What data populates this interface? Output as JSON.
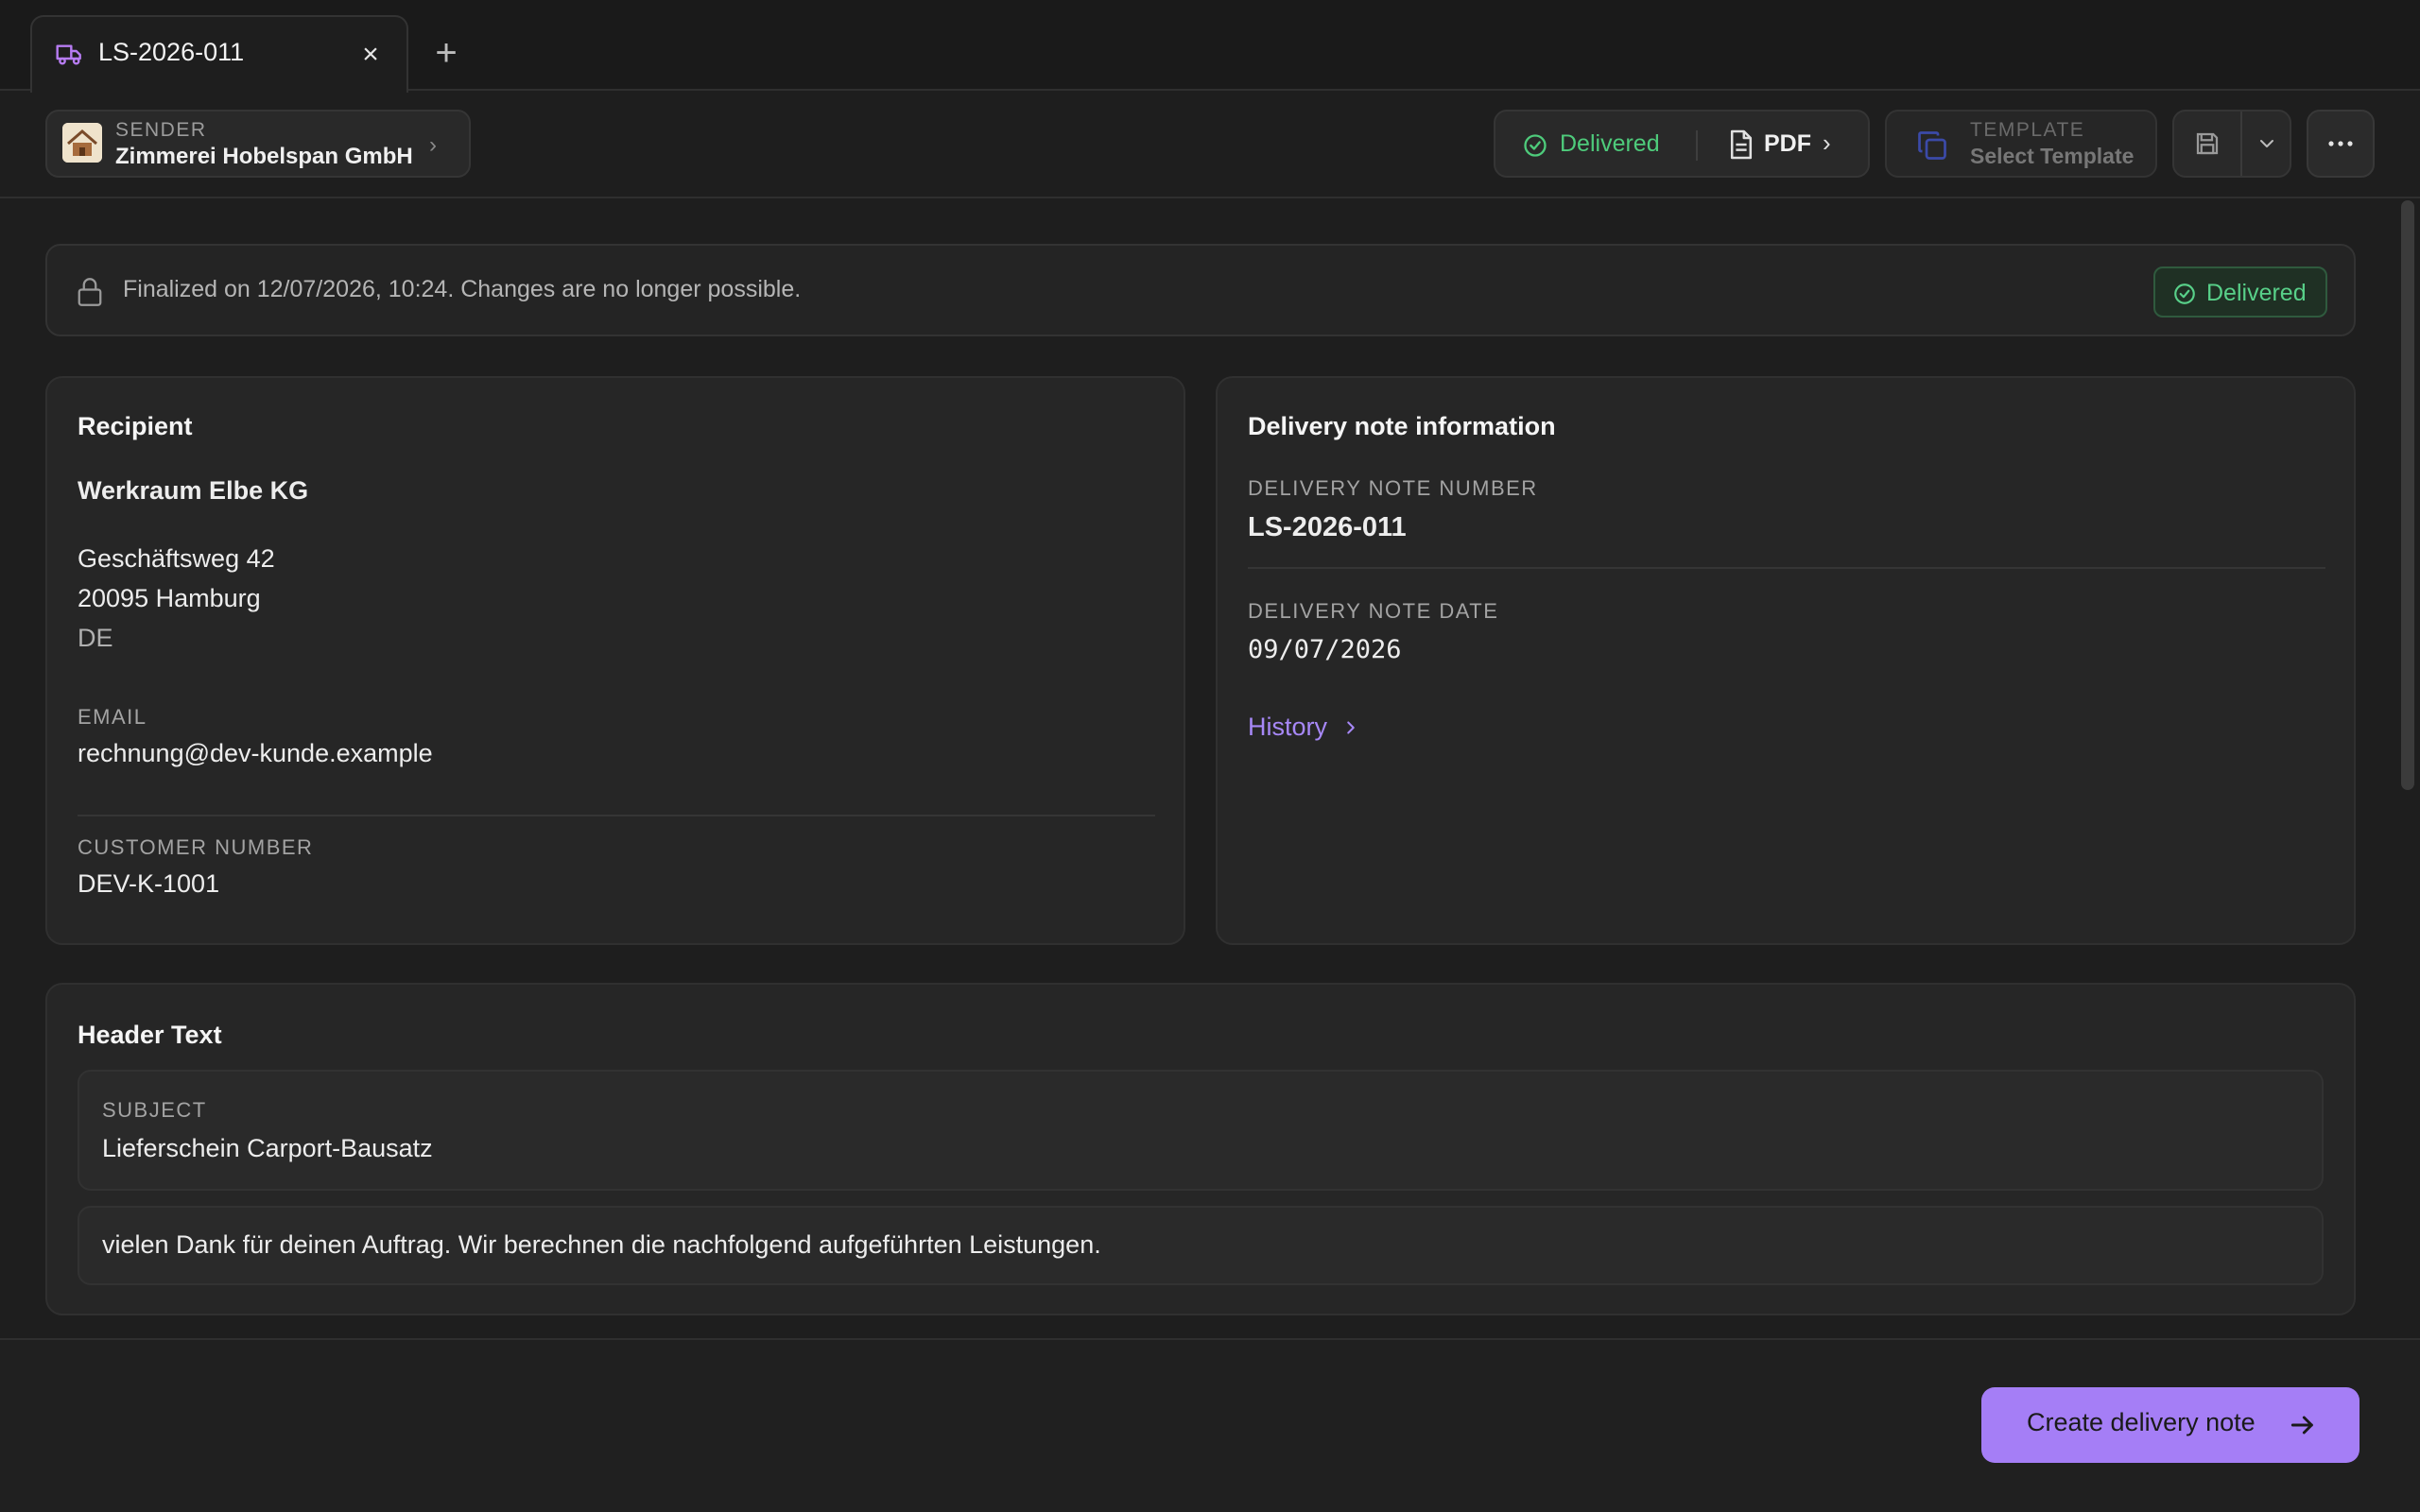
{
  "tab": {
    "title": "LS-2026-011",
    "close": "×",
    "add": "+"
  },
  "sender": {
    "label": "SENDER",
    "name": "Zimmerei Hobelspan GmbH"
  },
  "status": {
    "delivered": "Delivered",
    "pdf": "PDF"
  },
  "template": {
    "label": "TEMPLATE",
    "value": "Select Template"
  },
  "banner": {
    "text": "Finalized on 12/07/2026, 10:24. Changes are no longer possible.",
    "badge": "Delivered"
  },
  "recipient": {
    "title": "Recipient",
    "company": "Werkraum Elbe KG",
    "street": "Geschäftsweg 42",
    "city": "20095 Hamburg",
    "country": "DE",
    "email_label": "EMAIL",
    "email": "rechnung@dev-kunde.example",
    "customer_number_label": "CUSTOMER NUMBER",
    "customer_number": "DEV-K-1001"
  },
  "delivery_info": {
    "title": "Delivery note information",
    "number_label": "DELIVERY NOTE NUMBER",
    "number": "LS-2026-011",
    "date_label": "DELIVERY NOTE DATE",
    "date": "09/07/2026",
    "history": "History"
  },
  "header_text": {
    "title": "Header Text",
    "subject_label": "SUBJECT",
    "subject": "Lieferschein Carport-Bausatz",
    "body": "vielen Dank für deinen Auftrag. Wir berechnen die nachfolgend aufgeführten Leistungen."
  },
  "footer": {
    "create_label": "Create delivery note"
  },
  "colors": {
    "accent": "#a57ef6",
    "success": "#4ecb7b",
    "background": "#1e1e1e"
  }
}
